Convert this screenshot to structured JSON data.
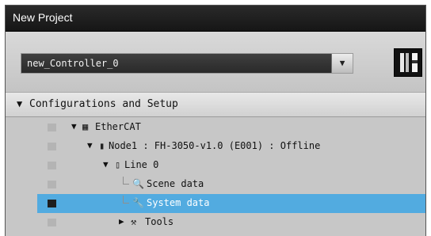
{
  "window": {
    "title": "New Project"
  },
  "controller_select": {
    "value": "new_Controller_0",
    "dropdown_glyph": "▼"
  },
  "section": {
    "arrow": "▼",
    "label": "Configurations and Setup"
  },
  "tree": {
    "items": [
      {
        "label": "EtherCAT",
        "toggle": "▼",
        "icon": "▦",
        "icon_name": "ethercat-icon",
        "selected": false
      },
      {
        "label": "Node1 : FH-3050-v1.0 (E001) : Offline",
        "toggle": "▼",
        "icon": "▮",
        "icon_name": "node-device-icon",
        "selected": false
      },
      {
        "label": "Line 0",
        "toggle": "▼",
        "icon": "▯",
        "icon_name": "line-icon",
        "selected": false
      },
      {
        "label": "Scene data",
        "toggle": "",
        "icon": "🔍",
        "icon_name": "scene-data-icon",
        "selected": false
      },
      {
        "label": "System data",
        "toggle": "",
        "icon": "🔧",
        "icon_name": "wrench-icon",
        "selected": true
      },
      {
        "label": "Tools",
        "toggle": "▶",
        "icon": "⚒",
        "icon_name": "tools-icon",
        "selected": false
      }
    ]
  },
  "colors": {
    "title_bar": "#1e1e1e",
    "panel_bg": "#c9c9c9",
    "selection": "#52abe0",
    "combo_bg": "#333333"
  }
}
